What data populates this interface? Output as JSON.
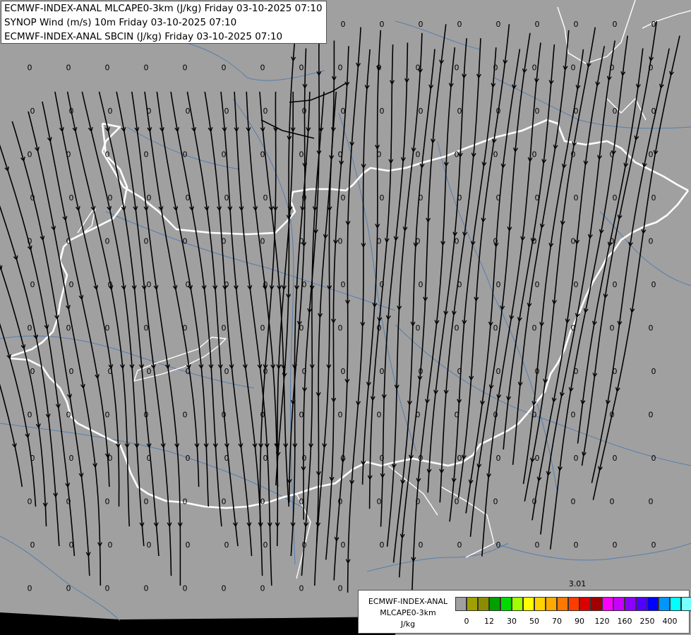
{
  "header": {
    "line1": "ECMWF-INDEX-ANAL MLCAPE0-3km (J/kg) Friday 03-10-2025 07:10",
    "line2": "SYNOP Wind (m/s) 10m Friday 03-10-2025 07:10",
    "line3": "ECMWF-INDEX-ANAL SBCIN (J/kg) Friday 03-10-2025 07:10"
  },
  "map": {
    "background_color": "#a0a0a0",
    "border_color": "#ffffff",
    "river_color": "#4a78b0",
    "streamline_color": "#000000",
    "grid_value_label": "0",
    "special_value_label": "3.01"
  },
  "legend": {
    "title_line1": "ECMWF-INDEX-ANAL",
    "title_line2": "MLCAPE0-3km",
    "unit": "J/kg",
    "colors": [
      "#a0a0a0",
      "#a0a000",
      "#8c8c00",
      "#00a000",
      "#00dc00",
      "#a0ff00",
      "#ffff00",
      "#ffd200",
      "#ffaa00",
      "#ff7800",
      "#ff3c00",
      "#dc0000",
      "#a00000",
      "#ff00ff",
      "#c800ff",
      "#8c00ff",
      "#5000ff",
      "#0000ff",
      "#0096ff",
      "#00ffff",
      "#78ffff",
      "#ffffff"
    ],
    "tick_labels": [
      "0",
      "12",
      "30",
      "50",
      "70",
      "90",
      "120",
      "160",
      "250",
      "400"
    ]
  }
}
